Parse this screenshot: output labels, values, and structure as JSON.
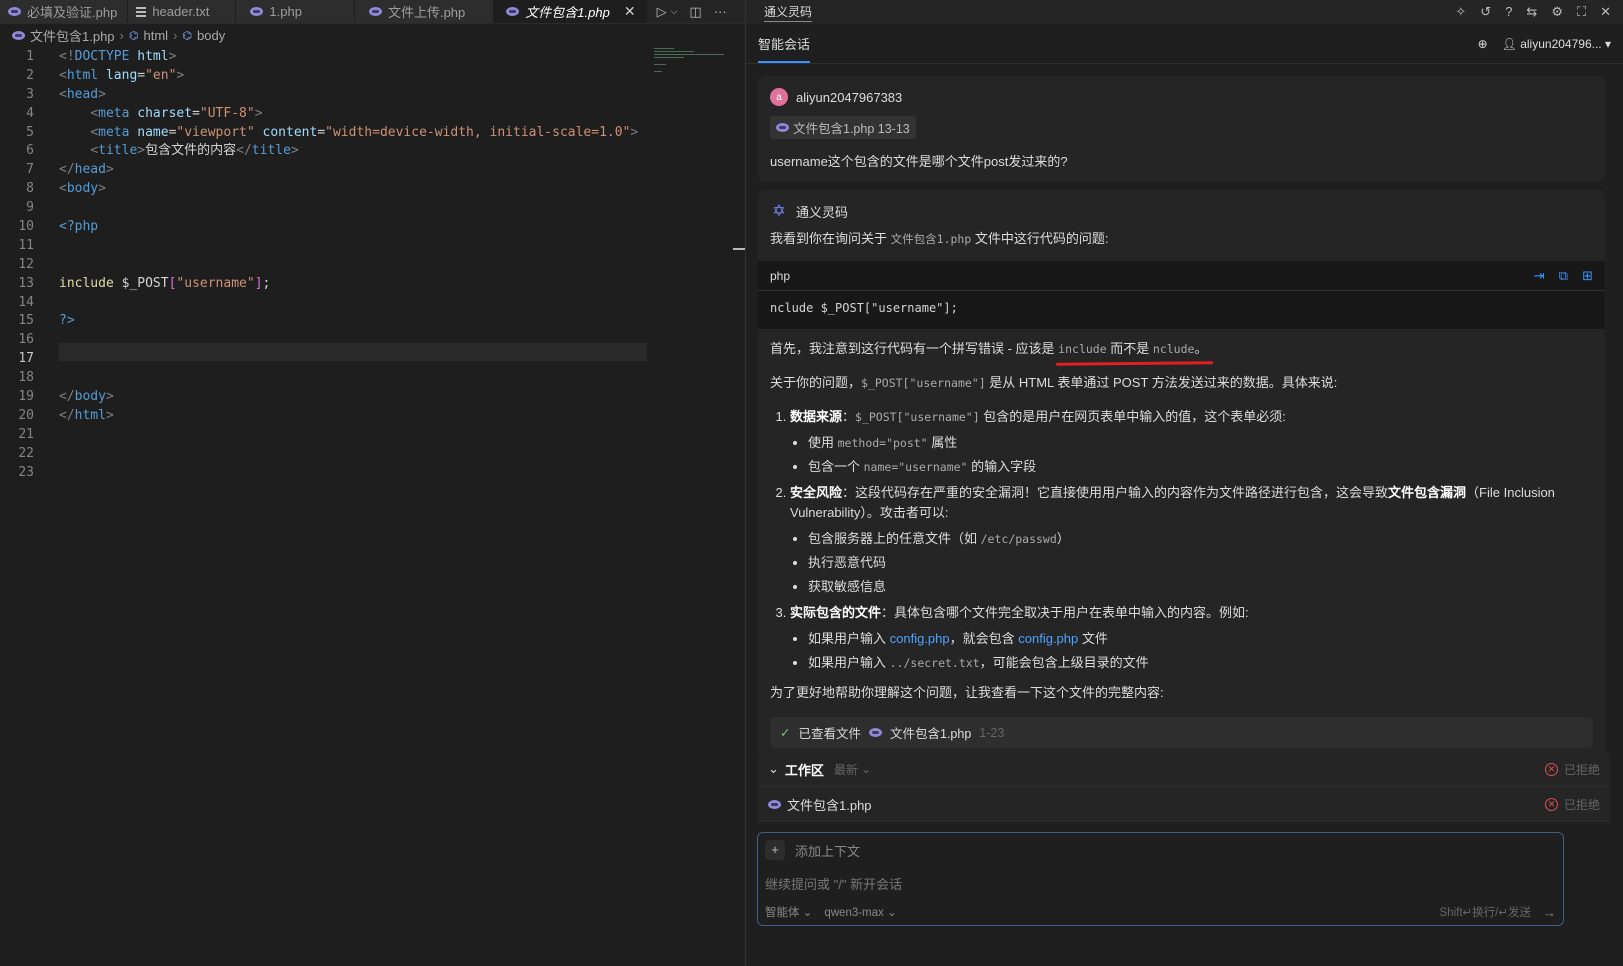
{
  "tabs": [
    {
      "label": "必填及验证.php",
      "icon": "php-icon"
    },
    {
      "label": "header.txt",
      "icon": "text-file-icon"
    },
    {
      "label": "1.php",
      "icon": "php-icon"
    },
    {
      "label": "文件上传.php",
      "icon": "php-icon"
    },
    {
      "label": "文件包含1.php",
      "icon": "php-icon",
      "active": true
    }
  ],
  "breadcrumb": {
    "file": "文件包含1.php",
    "node1": "html",
    "node2": "body"
  },
  "editor": {
    "current_line": "17",
    "line_numbers": [
      "1",
      "2",
      "3",
      "4",
      "5",
      "6",
      "7",
      "8",
      "9",
      "10",
      "11",
      "12",
      "13",
      "14",
      "15",
      "16",
      "17",
      "18",
      "19",
      "20",
      "21",
      "22",
      "23"
    ]
  },
  "code": {
    "l1_a": "<!",
    "l1_b": "DOCTYPE",
    "l1_c": " html",
    "l2_tag": "html",
    "l2_attr": "lang",
    "l2_val": "\"en\"",
    "l3_tag": "head",
    "l4_tag": "meta",
    "l4_attr": "charset",
    "l4_val": "\"UTF-8\"",
    "l5_tag": "meta",
    "l5_attr1": "name",
    "l5_val1": "\"viewport\"",
    "l5_attr2": "content",
    "l5_val2": "\"width=device-width, initial-scale=1.0\"",
    "l6_tag": "title",
    "l6_text": "包含文件的内容",
    "l6_close": "title",
    "l7_close": "head",
    "l8_tag": "body",
    "l10": "<?php",
    "l13_kw": "include",
    "l13_var": " $_POST",
    "l13_key": "\"username\"",
    "l13_end": ";",
    "l15": "?>",
    "l19_close": "body",
    "l20_close": "html"
  },
  "chat": {
    "panel_title": "通义灵码",
    "session_title": "智能会话",
    "account": "aliyun204796...",
    "user": {
      "avatar": "a",
      "name": "aliyun2047967383",
      "ref": "文件包含1.php 13-13",
      "question": "username这个包含的文件是哪个文件post发过来的?"
    },
    "bot": {
      "name": "通义灵码",
      "intro_a": "我看到你在询问关于 ",
      "intro_file": "文件包含1.php",
      "intro_b": " 文件中这行代码的问题:",
      "code_lang": "php",
      "code_line": "nclude $_POST[\"username\"];",
      "typo_a": "首先，我注意到这行代码有一个拼写错误 - 应该是 ",
      "typo_good": "include",
      "typo_b": " 而不是 ",
      "typo_bad": "nclude",
      "typo_c": "。",
      "about_a": "关于你的问题，",
      "about_code": "$_POST[\"username\"]",
      "about_b": " 是从 HTML 表单通过 POST 方法发送过来的数据。具体来说:",
      "i1_title": "数据来源",
      "i1_a": "：",
      "i1_code": "$_POST[\"username\"]",
      "i1_b": " 包含的是用户在网页表单中输入的值，这个表单必须:",
      "i1_s1_a": "使用 ",
      "i1_s1_code": "method=\"post\"",
      "i1_s1_b": " 属性",
      "i1_s2_a": "包含一个 ",
      "i1_s2_code": "name=\"username\"",
      "i1_s2_b": " 的输入字段",
      "i2_title": "安全风险",
      "i2_a": "：这段代码存在严重的安全漏洞！它直接使用用户输入的内容作为文件路径进行包含，这会导致",
      "i2_bold": "文件包含漏洞",
      "i2_b": "（File Inclusion Vulnerability）。攻击者可以:",
      "i2_s1_a": "包含服务器上的任意文件（如 ",
      "i2_s1_code": "/etc/passwd",
      "i2_s1_b": "）",
      "i2_s2": "执行恶意代码",
      "i2_s3": "获取敏感信息",
      "i3_title": "实际包含的文件",
      "i3_a": "：具体包含哪个文件完全取决于用户在表单中输入的内容。例如:",
      "i3_s1_a": "如果用户输入 ",
      "i3_s1_link": "config.php",
      "i3_s1_b": "，就会包含 ",
      "i3_s1_link2": "config.php",
      "i3_s1_c": " 文件",
      "i3_s2_a": "如果用户输入 ",
      "i3_s2_code": "../secret.txt",
      "i3_s2_b": "，可能会包含上级目录的文件",
      "outro": "为了更好地帮助你理解这个问题，让我查看一下这个文件的完整内容:",
      "viewed_label": "已查看文件",
      "viewed_file": "文件包含1.php",
      "viewed_range": "1-23"
    }
  },
  "workspace": {
    "title": "工作区",
    "latest": "最新",
    "file": "文件包含1.php",
    "status": "已拒绝"
  },
  "input": {
    "add_context": "添加上下文",
    "placeholder": "继续提问或 \"/\" 新开会话",
    "mode": "智能体",
    "model": "qwen3-max",
    "hint": "Shift↵换行/↵发送"
  }
}
